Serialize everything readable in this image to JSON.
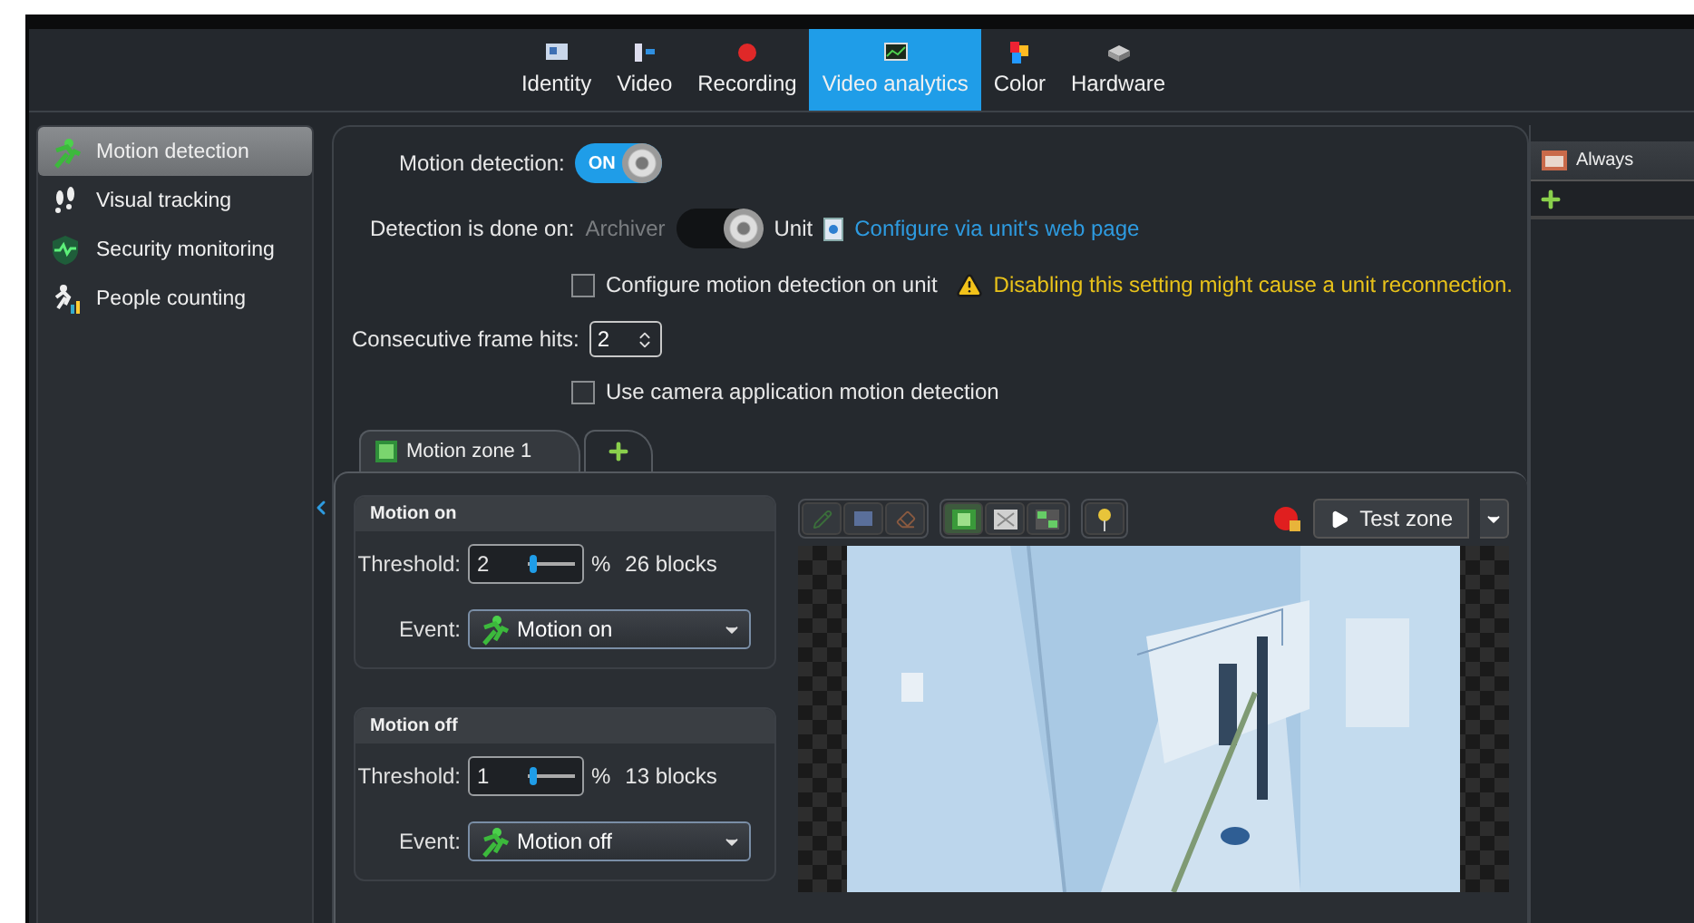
{
  "tabs": [
    {
      "label": "Identity",
      "selected": false,
      "kind": "identity"
    },
    {
      "label": "Video",
      "selected": false,
      "kind": "video"
    },
    {
      "label": "Recording",
      "selected": false,
      "kind": "recording"
    },
    {
      "label": "Video analytics",
      "selected": true,
      "kind": "analytics"
    },
    {
      "label": "Color",
      "selected": false,
      "kind": "color"
    },
    {
      "label": "Hardware",
      "selected": false,
      "kind": "hardware"
    }
  ],
  "sidebar": {
    "items": [
      {
        "label": "Motion detection",
        "selected": true,
        "kind": "motion"
      },
      {
        "label": "Visual tracking",
        "selected": false,
        "kind": "tracking"
      },
      {
        "label": "Security monitoring",
        "selected": false,
        "kind": "security"
      },
      {
        "label": "People counting",
        "selected": false,
        "kind": "counting"
      }
    ]
  },
  "settings": {
    "motion_detection": {
      "label": "Motion detection:",
      "toggle_text": "ON",
      "on": true
    },
    "detection_on": {
      "label": "Detection is done on:",
      "left_option": "Archiver",
      "right_option": "Unit",
      "on": true,
      "link": "Configure via unit's web page"
    },
    "configure_on_unit": {
      "label": "Configure motion detection on unit",
      "checked": false,
      "warning": "Disabling this setting might cause a unit reconnection."
    },
    "frame_hits": {
      "label": "Consecutive frame hits:",
      "value": "2"
    },
    "camera_app": {
      "label": "Use camera application motion detection",
      "checked": false
    }
  },
  "zone_tabs": [
    {
      "label": "Motion zone 1",
      "selected": true
    }
  ],
  "groups": [
    {
      "title": "Motion on",
      "threshold_label": "Threshold:",
      "threshold": "2",
      "level": 0.1,
      "unit": "%",
      "blocks": "26 blocks",
      "event_label": "Event:",
      "event": "Motion on"
    },
    {
      "title": "Motion off",
      "threshold_label": "Threshold:",
      "threshold": "1",
      "level": 0.1,
      "unit": "%",
      "blocks": "13 blocks",
      "event_label": "Event:",
      "event": "Motion off"
    }
  ],
  "test_button": "Test zone",
  "schedule": {
    "items": [
      {
        "label": "Always"
      }
    ]
  }
}
